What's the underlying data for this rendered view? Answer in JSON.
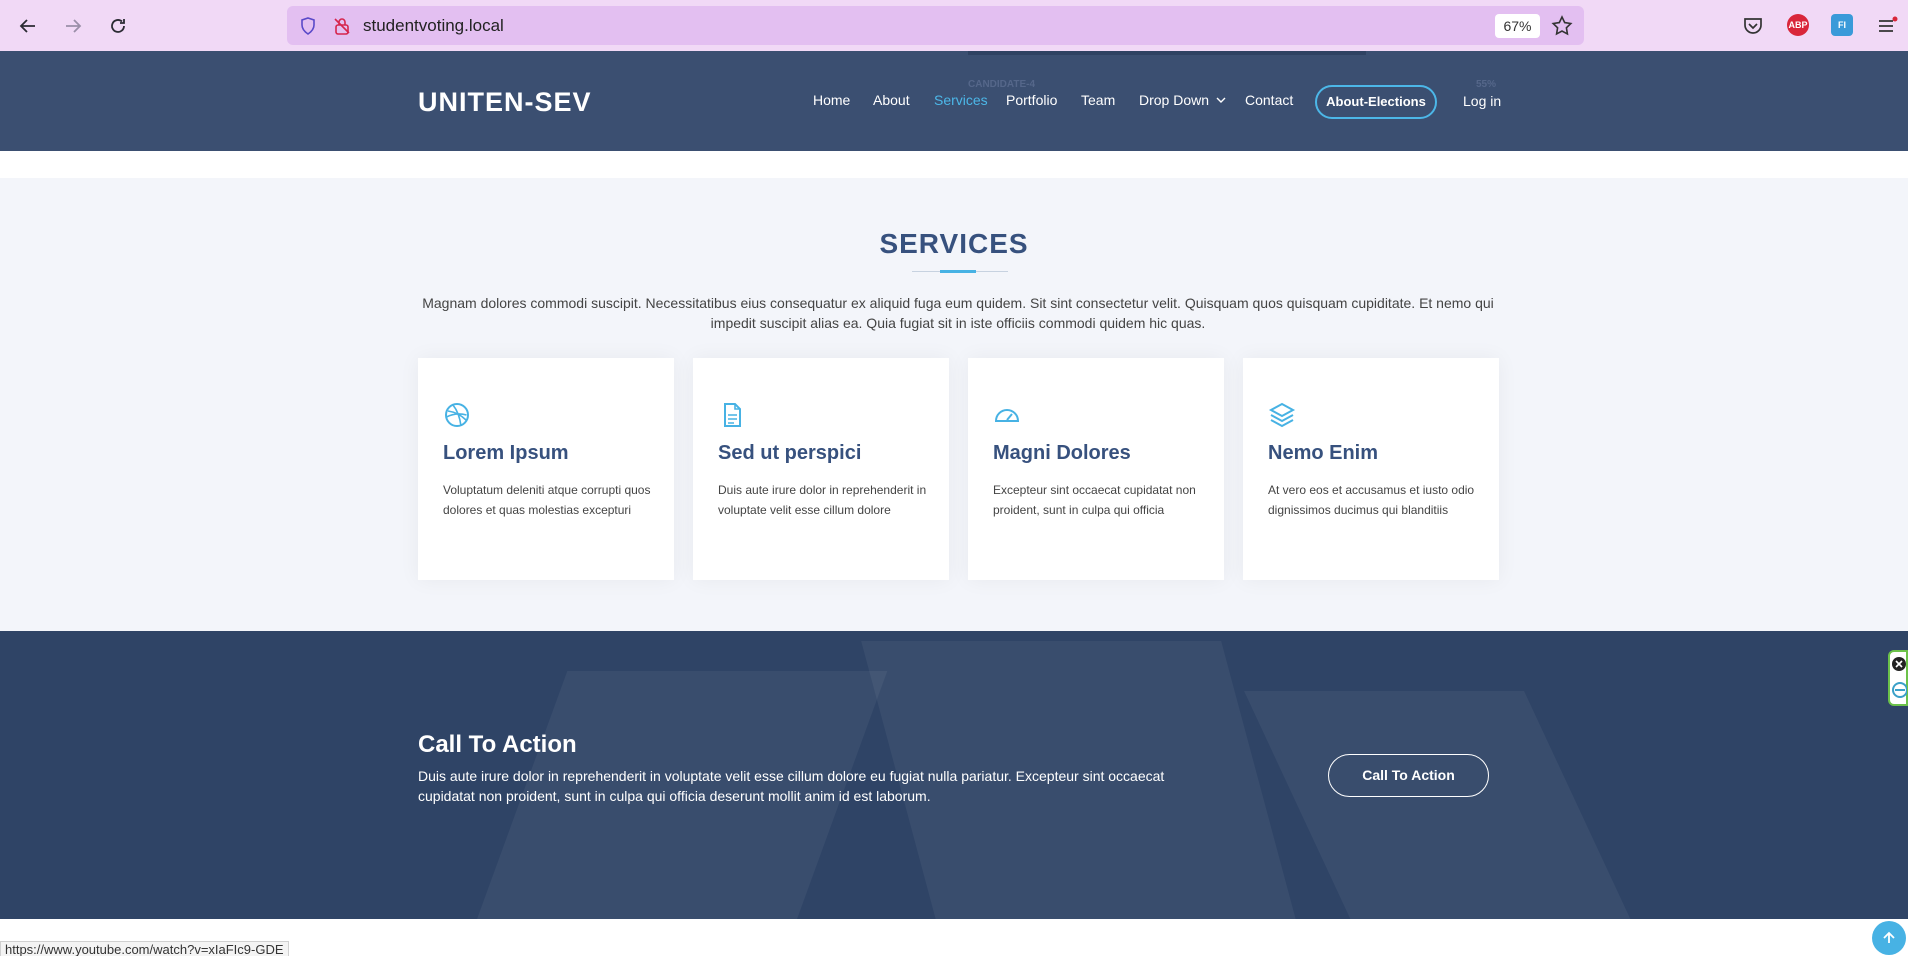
{
  "browser": {
    "url": "studentvoting.local",
    "zoom": "67%",
    "status_url": "https://www.youtube.com/watch?v=xIaFIc9-GDE",
    "ext_abp": "ABP",
    "ext_fi": "FI"
  },
  "header": {
    "logo": "UNITEN-SEV",
    "ghost_label": "CANDIDATE-4",
    "ghost_pct": "55%",
    "menu": [
      "Home",
      "About",
      "Services",
      "Portfolio",
      "Team",
      "Drop Down",
      "Contact"
    ],
    "active_item": "Services",
    "elections_button": "About-Elections",
    "login": "Log in"
  },
  "services": {
    "title": "SERVICES",
    "description": "Magnam dolores commodi suscipit. Necessitatibus eius consequatur ex aliquid fuga eum quidem. Sit sint consectetur velit. Quisquam quos quisquam cupiditate. Et nemo qui impedit suscipit alias ea. Quia fugiat sit in iste officiis commodi quidem hic quas.",
    "cards": [
      {
        "icon": "dribbble-icon",
        "title": "Lorem Ipsum",
        "text": "Voluptatum deleniti atque corrupti quos dolores et quas molestias excepturi"
      },
      {
        "icon": "file-icon",
        "title": "Sed ut perspici",
        "text": "Duis aute irure dolor in reprehenderit in voluptate velit esse cillum dolore"
      },
      {
        "icon": "speedometer-icon",
        "title": "Magni Dolores",
        "text": "Excepteur sint occaecat cupidatat non proident, sunt in culpa qui officia"
      },
      {
        "icon": "layers-icon",
        "title": "Nemo Enim",
        "text": "At vero eos et accusamus et iusto odio dignissimos ducimus qui blanditiis"
      }
    ]
  },
  "cta": {
    "title": "Call To Action",
    "text": "Duis aute irure dolor in reprehenderit in voluptate velit esse cillum dolore eu fugiat nulla pariatur. Excepteur sint occaecat cupidatat non proident, sunt in culpa qui officia deserunt mollit anim id est laborum.",
    "button": "Call To Action"
  },
  "colors": {
    "accent": "#47b2e4",
    "heading": "#37517e",
    "header_bg": "#3b4f71",
    "cta_bg": "#2f4466"
  }
}
